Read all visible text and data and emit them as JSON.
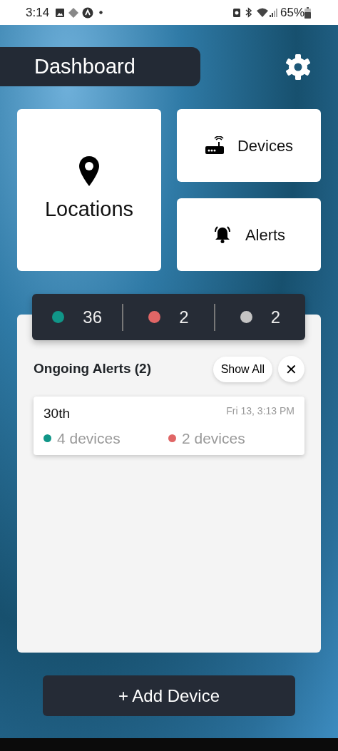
{
  "status_bar": {
    "time": "3:14",
    "battery": "65%"
  },
  "header": {
    "title": "Dashboard"
  },
  "tiles": [
    {
      "kind": "locations",
      "label": "Locations"
    },
    {
      "kind": "devices",
      "label": "Devices"
    },
    {
      "kind": "alerts",
      "label": "Alerts"
    }
  ],
  "counts": [
    {
      "color": "#109688",
      "value": "36"
    },
    {
      "color": "#e06666",
      "value": "2"
    },
    {
      "color": "#c4c4c4",
      "value": "2"
    }
  ],
  "alerts_panel": {
    "title": "Ongoing Alerts (2)",
    "show_all": "Show All",
    "close": "✕",
    "alerts": [
      {
        "name": "30th",
        "time": "Fri 13, 3:13 PM",
        "groups": [
          {
            "color": "#109688",
            "text": "4 devices"
          },
          {
            "color": "#e06666",
            "text": "2 devices"
          }
        ]
      }
    ]
  },
  "add_button": "+ Add Device"
}
